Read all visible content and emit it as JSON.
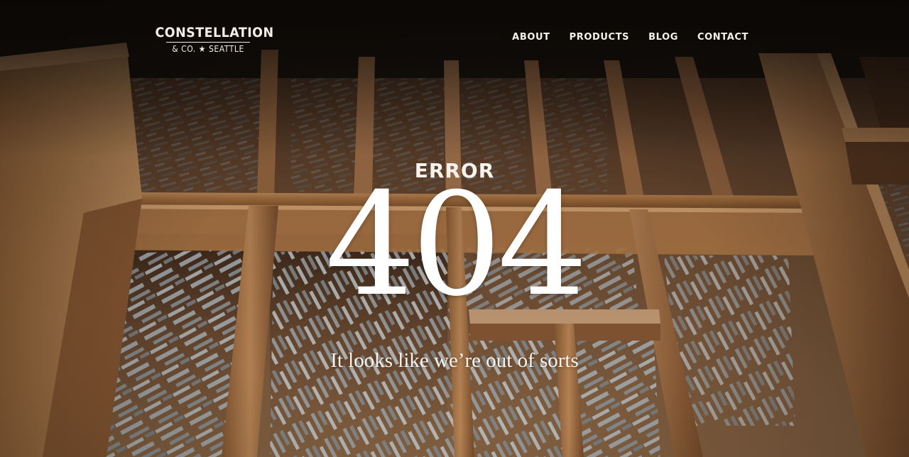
{
  "logo": {
    "title": "CONSTELLATION",
    "subtitle": "& CO. ★ SEATTLE"
  },
  "nav": {
    "items": [
      {
        "label": "ABOUT"
      },
      {
        "label": "PRODUCTS"
      },
      {
        "label": "BLOG"
      },
      {
        "label": "CONTACT"
      }
    ]
  },
  "error": {
    "label": "ERROR",
    "code": "404",
    "message": "It looks like we’re out of sorts"
  },
  "colors": {
    "text": "#f6f2ee",
    "wood_light": "#b98455",
    "wood_dark": "#5e3b22",
    "metal_type": "#9aa0a3"
  }
}
